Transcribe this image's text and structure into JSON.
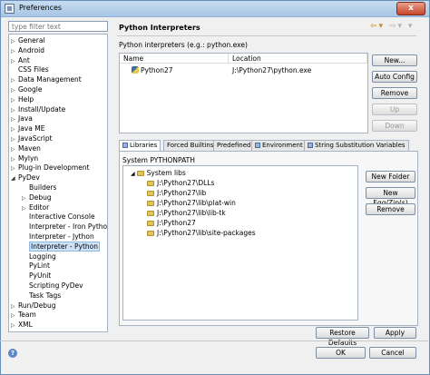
{
  "window": {
    "title": "Preferences",
    "close_label": "x"
  },
  "filter": {
    "placeholder": "type filter text"
  },
  "tree": {
    "items": [
      {
        "label": "General",
        "arrow": "▷"
      },
      {
        "label": "Android",
        "arrow": "▷"
      },
      {
        "label": "Ant",
        "arrow": "▷"
      },
      {
        "label": "CSS Files",
        "arrow": ""
      },
      {
        "label": "Data Management",
        "arrow": "▷"
      },
      {
        "label": "Google",
        "arrow": "▷"
      },
      {
        "label": "Help",
        "arrow": "▷"
      },
      {
        "label": "Install/Update",
        "arrow": "▷"
      },
      {
        "label": "Java",
        "arrow": "▷"
      },
      {
        "label": "Java ME",
        "arrow": "▷"
      },
      {
        "label": "JavaScript",
        "arrow": "▷"
      },
      {
        "label": "Maven",
        "arrow": "▷"
      },
      {
        "label": "Mylyn",
        "arrow": "▷"
      },
      {
        "label": "Plug-in Development",
        "arrow": "▷"
      },
      {
        "label": "PyDev",
        "arrow": "◢"
      },
      {
        "label": "Builders",
        "arrow": ""
      },
      {
        "label": "Debug",
        "arrow": "▷"
      },
      {
        "label": "Editor",
        "arrow": "▷"
      },
      {
        "label": "Interactive Console",
        "arrow": ""
      },
      {
        "label": "Interpreter - Iron Python",
        "arrow": ""
      },
      {
        "label": "Interpreter - Jython",
        "arrow": ""
      },
      {
        "label": "Interpreter - Python",
        "arrow": ""
      },
      {
        "label": "Logging",
        "arrow": ""
      },
      {
        "label": "PyLint",
        "arrow": ""
      },
      {
        "label": "PyUnit",
        "arrow": ""
      },
      {
        "label": "Scripting PyDev",
        "arrow": ""
      },
      {
        "label": "Task Tags",
        "arrow": ""
      },
      {
        "label": "Run/Debug",
        "arrow": "▷"
      },
      {
        "label": "Team",
        "arrow": "▷"
      },
      {
        "label": "XML",
        "arrow": "▷"
      }
    ]
  },
  "page": {
    "title": "Python Interpreters",
    "description": "Python interpreters (e.g.: python.exe)",
    "nav_back": "⇦",
    "nav_back_menu": "▾",
    "nav_fwd": "⇨",
    "nav_fwd_menu": "▾",
    "nav_view_menu": "▾"
  },
  "interpreters": {
    "columns": [
      "Name",
      "Location"
    ],
    "rows": [
      {
        "name": "Python27",
        "location": "J:\\Python27\\python.exe"
      }
    ]
  },
  "interp_buttons": {
    "new": "New...",
    "auto": "Auto Config",
    "remove": "Remove",
    "up": "Up",
    "down": "Down"
  },
  "tabs": [
    {
      "label": "Libraries"
    },
    {
      "label": "Forced Builtins"
    },
    {
      "label": "Predefined"
    },
    {
      "label": "Environment"
    },
    {
      "label": "String Substitution Variables"
    }
  ],
  "libraries": {
    "section_label": "System PYTHONPATH",
    "root": "System libs",
    "paths": [
      "J:\\Python27\\DLLs",
      "J:\\Python27\\lib",
      "J:\\Python27\\lib\\plat-win",
      "J:\\Python27\\lib\\lib-tk",
      "J:\\Python27",
      "J:\\Python27\\lib\\site-packages"
    ]
  },
  "lib_buttons": {
    "new_folder": "New Folder",
    "new_egg": "New Egg/Zip(s)",
    "remove": "Remove"
  },
  "footer": {
    "restore": "Restore Defaults",
    "apply": "Apply",
    "ok": "OK",
    "cancel": "Cancel",
    "help": "?"
  }
}
